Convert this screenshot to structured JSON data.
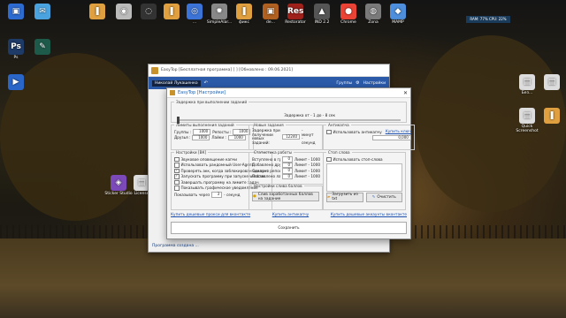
{
  "desktop": {
    "icons": [
      {
        "label": "",
        "glyph": "▣",
        "color": "#2d6bd1"
      },
      {
        "label": "",
        "glyph": "✉",
        "color": "#4aa3df"
      },
      {
        "label": "",
        "glyph": "❚",
        "color": "#e0a040"
      },
      {
        "label": "",
        "glyph": "◉",
        "color": "#bbb"
      },
      {
        "label": "",
        "glyph": "◌",
        "color": "#333"
      },
      {
        "label": "",
        "glyph": "❚",
        "color": "#e0a040"
      },
      {
        "label": "...",
        "glyph": "◎",
        "color": "#3b73d6"
      },
      {
        "label": "SimpleAlar...",
        "glyph": "✹",
        "color": "#888"
      },
      {
        "label": "фикс",
        "glyph": "❚",
        "color": "#e0a040"
      },
      {
        "label": "de...",
        "glyph": "▣",
        "color": "#b06020"
      },
      {
        "label": "Restorator",
        "glyph": "Res",
        "color": "#a0201a"
      },
      {
        "label": "IND 2.2",
        "glyph": "▲",
        "color": "#555"
      },
      {
        "label": "Chrome",
        "glyph": "●",
        "color": "#ea4335"
      },
      {
        "label": "Zona",
        "glyph": "◍",
        "color": "#7a7a7a"
      },
      {
        "label": "MAMP",
        "glyph": "◆",
        "color": "#4d8fdc"
      },
      {
        "label": "Ps",
        "glyph": "Ps",
        "color": "#1e3a66"
      },
      {
        "label": "",
        "glyph": "✎",
        "color": "#1e5a4a"
      },
      {
        "label": "",
        "glyph": "▶",
        "color": "#2a66c8"
      },
      {
        "label": "Sticker Studio",
        "glyph": "◈",
        "color": "#7b4ab8"
      },
      {
        "label": "License",
        "glyph": "▤",
        "color": "#ddd"
      },
      {
        "label": "Новая папка",
        "glyph": "❚",
        "color": "#e0a040"
      },
      {
        "label": "Без...",
        "glyph": "▤",
        "color": "#ddd"
      },
      {
        "label": "",
        "glyph": "▤",
        "color": "#ddd"
      },
      {
        "label": "Quick Screenshot",
        "glyph": "▤",
        "color": "#ddd"
      },
      {
        "label": "",
        "glyph": "❚",
        "color": "#e0a040"
      }
    ],
    "tray_text": "RAM: 77% CPU: 22%"
  },
  "main_window": {
    "title": "EasyTop [Бесплатная программа] [ ] [Обновлено : 09.06.2021]",
    "account": "Николай Лукашенко",
    "link_groups": "Группы",
    "link_settings": "Настройки",
    "footer": "Программа создана ..."
  },
  "dialog": {
    "title": "EasyTop [Настройки]",
    "close": "✕",
    "delay_group": {
      "legend": "Задержка при выполнении заданий",
      "text": "Задержка от - 1 до - 8 сек"
    },
    "limits": {
      "legend": "Лимиты выполнения заданий",
      "rows": [
        {
          "l1": "Группы :",
          "v1": "1000",
          "l2": "Репосты :",
          "v2": "1000"
        },
        {
          "l1": "Друзья :",
          "v1": "1000",
          "l2": "Лайки :",
          "v2": "1000"
        }
      ]
    },
    "new_tasks": {
      "legend": "Новые задания",
      "label": "Задержка при получении новых заданий:",
      "value": "12240",
      "unit": "- минут - секунд"
    },
    "anticaptcha": {
      "legend": "Антикапча",
      "checkbox": "Использовать антикапчу",
      "link": "Купить ключ",
      "value": "0,000"
    },
    "settings": {
      "legend": "Настройки [ВК]",
      "items": [
        {
          "text": "Звуковое оповещение капчи",
          "checked": false
        },
        {
          "text": "Использовать рандомный User-Agent",
          "checked": false
        },
        {
          "text": "Проверять акк, когда заблокирован аккаунт",
          "checked": true
        },
        {
          "text": "Запускать программу при запуске windows",
          "checked": true
        },
        {
          "text": "Завершать программу на лимите задач",
          "checked": false
        },
        {
          "text": "Показывать графическое уведомление",
          "checked": false
        }
      ],
      "show_label": "Показывать через",
      "show_value": "3",
      "show_unit": "- секунд"
    },
    "stats": {
      "legend": "Статистика работы",
      "rows": [
        {
          "label": "Вступлено в группы :",
          "value": "0",
          "limit": "Лимит - 1000"
        },
        {
          "label": "Добавлено друзей :",
          "value": "0",
          "limit": "Лимит - 1000"
        },
        {
          "label": "Сделано репостов :",
          "value": "0",
          "limit": "Лимит - 1000"
        },
        {
          "label": "Поставлено лайков :",
          "value": "0",
          "limit": "Лимит - 1000"
        }
      ]
    },
    "stop_words": {
      "legend": "Стоп слова",
      "checkbox": "Использовать стоп-слова"
    },
    "balance": {
      "legend": "Настройки слива баллов",
      "button": "Слив заработанных баллов на задание"
    },
    "load_button": "Загрузить из txt",
    "clear_button": "Очистить",
    "bottom_links": [
      "Купить дешевые прокси для вконтакте",
      "Купить антикапчу",
      "Купить дешевые аккаунты вконтакте"
    ],
    "save_button": "Сохранить"
  }
}
